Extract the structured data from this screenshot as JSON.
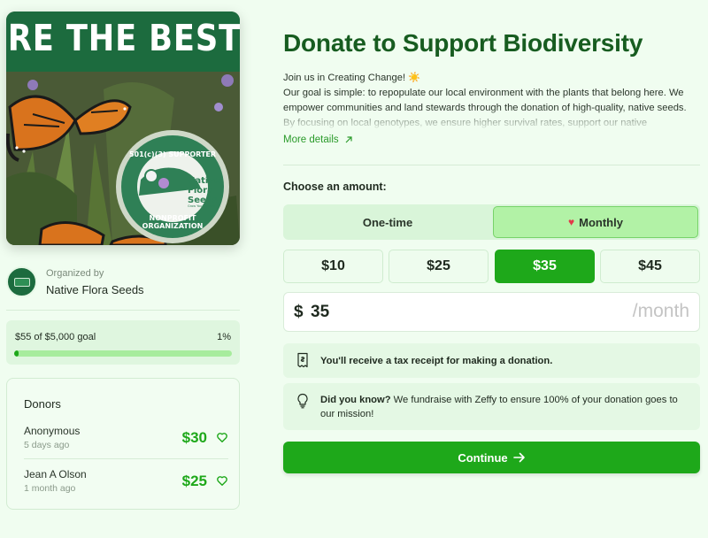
{
  "hero": {
    "banner_text": "RE THE BEST!",
    "badge_top": "501(c)(3) SUPPORTER",
    "badge_brand": [
      "Native",
      "Flora",
      "Seeds"
    ],
    "badge_tagline": "Grow Your Impact",
    "badge_bottom": [
      "NONPROFIT",
      "ORGANIZATION"
    ]
  },
  "organizer": {
    "label": "Organized by",
    "name": "Native Flora Seeds"
  },
  "progress": {
    "text": "$55 of $5,000 goal",
    "percent_label": "1%",
    "fraction": 0.011
  },
  "donors": {
    "title": "Donors",
    "items": [
      {
        "name": "Anonymous",
        "time": "5 days ago",
        "amount": "$30"
      },
      {
        "name": "Jean A Olson",
        "time": "1 month ago",
        "amount": "$25"
      }
    ]
  },
  "campaign": {
    "title": "Donate to Support Biodiversity",
    "intro": "Join us in Creating Change! ☀️",
    "body": "Our goal is simple: to repopulate our local environment with the plants that belong here. We empower communities and land stewards through the donation of high-quality, native seeds. By focusing on local genotypes, we ensure higher survival rates, support our native",
    "more_label": "More details"
  },
  "amount_section": {
    "label": "Choose an amount:",
    "frequency": {
      "one_time": "One-time",
      "monthly": "Monthly",
      "selected": "Monthly"
    },
    "presets": [
      "$10",
      "$25",
      "$35",
      "$45"
    ],
    "selected_preset": "$35",
    "currency_symbol": "$",
    "custom_value": "35",
    "suffix": "/month"
  },
  "notices": {
    "tax": "You'll receive a tax receipt for making a donation.",
    "did_you_know_bold": "Did you know?",
    "did_you_know_text": " We fundraise with Zeffy to ensure 100% of your donation goes to our mission!"
  },
  "actions": {
    "continue": "Continue"
  },
  "colors": {
    "brand_green": "#1ea81a",
    "title_green": "#175c20",
    "monthly_selected": "#b2f2a6",
    "page_bg": "#f0fdf0"
  },
  "icons": {
    "more": "arrow-up-right-icon",
    "heart": "heart-icon",
    "receipt": "receipt-icon",
    "bulb": "lightbulb-icon",
    "continue": "arrow-right-icon"
  }
}
